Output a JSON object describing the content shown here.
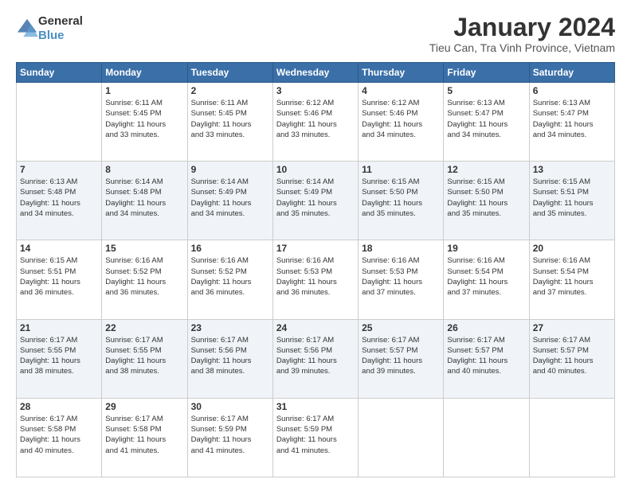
{
  "header": {
    "logo_general": "General",
    "logo_blue": "Blue",
    "title": "January 2024",
    "subtitle": "Tieu Can, Tra Vinh Province, Vietnam"
  },
  "days_of_week": [
    "Sunday",
    "Monday",
    "Tuesday",
    "Wednesday",
    "Thursday",
    "Friday",
    "Saturday"
  ],
  "weeks": [
    [
      {
        "day": "",
        "info": ""
      },
      {
        "day": "1",
        "info": "Sunrise: 6:11 AM\nSunset: 5:45 PM\nDaylight: 11 hours\nand 33 minutes."
      },
      {
        "day": "2",
        "info": "Sunrise: 6:11 AM\nSunset: 5:45 PM\nDaylight: 11 hours\nand 33 minutes."
      },
      {
        "day": "3",
        "info": "Sunrise: 6:12 AM\nSunset: 5:46 PM\nDaylight: 11 hours\nand 33 minutes."
      },
      {
        "day": "4",
        "info": "Sunrise: 6:12 AM\nSunset: 5:46 PM\nDaylight: 11 hours\nand 34 minutes."
      },
      {
        "day": "5",
        "info": "Sunrise: 6:13 AM\nSunset: 5:47 PM\nDaylight: 11 hours\nand 34 minutes."
      },
      {
        "day": "6",
        "info": "Sunrise: 6:13 AM\nSunset: 5:47 PM\nDaylight: 11 hours\nand 34 minutes."
      }
    ],
    [
      {
        "day": "7",
        "info": "Sunrise: 6:13 AM\nSunset: 5:48 PM\nDaylight: 11 hours\nand 34 minutes."
      },
      {
        "day": "8",
        "info": "Sunrise: 6:14 AM\nSunset: 5:48 PM\nDaylight: 11 hours\nand 34 minutes."
      },
      {
        "day": "9",
        "info": "Sunrise: 6:14 AM\nSunset: 5:49 PM\nDaylight: 11 hours\nand 34 minutes."
      },
      {
        "day": "10",
        "info": "Sunrise: 6:14 AM\nSunset: 5:49 PM\nDaylight: 11 hours\nand 35 minutes."
      },
      {
        "day": "11",
        "info": "Sunrise: 6:15 AM\nSunset: 5:50 PM\nDaylight: 11 hours\nand 35 minutes."
      },
      {
        "day": "12",
        "info": "Sunrise: 6:15 AM\nSunset: 5:50 PM\nDaylight: 11 hours\nand 35 minutes."
      },
      {
        "day": "13",
        "info": "Sunrise: 6:15 AM\nSunset: 5:51 PM\nDaylight: 11 hours\nand 35 minutes."
      }
    ],
    [
      {
        "day": "14",
        "info": "Sunrise: 6:15 AM\nSunset: 5:51 PM\nDaylight: 11 hours\nand 36 minutes."
      },
      {
        "day": "15",
        "info": "Sunrise: 6:16 AM\nSunset: 5:52 PM\nDaylight: 11 hours\nand 36 minutes."
      },
      {
        "day": "16",
        "info": "Sunrise: 6:16 AM\nSunset: 5:52 PM\nDaylight: 11 hours\nand 36 minutes."
      },
      {
        "day": "17",
        "info": "Sunrise: 6:16 AM\nSunset: 5:53 PM\nDaylight: 11 hours\nand 36 minutes."
      },
      {
        "day": "18",
        "info": "Sunrise: 6:16 AM\nSunset: 5:53 PM\nDaylight: 11 hours\nand 37 minutes."
      },
      {
        "day": "19",
        "info": "Sunrise: 6:16 AM\nSunset: 5:54 PM\nDaylight: 11 hours\nand 37 minutes."
      },
      {
        "day": "20",
        "info": "Sunrise: 6:16 AM\nSunset: 5:54 PM\nDaylight: 11 hours\nand 37 minutes."
      }
    ],
    [
      {
        "day": "21",
        "info": "Sunrise: 6:17 AM\nSunset: 5:55 PM\nDaylight: 11 hours\nand 38 minutes."
      },
      {
        "day": "22",
        "info": "Sunrise: 6:17 AM\nSunset: 5:55 PM\nDaylight: 11 hours\nand 38 minutes."
      },
      {
        "day": "23",
        "info": "Sunrise: 6:17 AM\nSunset: 5:56 PM\nDaylight: 11 hours\nand 38 minutes."
      },
      {
        "day": "24",
        "info": "Sunrise: 6:17 AM\nSunset: 5:56 PM\nDaylight: 11 hours\nand 39 minutes."
      },
      {
        "day": "25",
        "info": "Sunrise: 6:17 AM\nSunset: 5:57 PM\nDaylight: 11 hours\nand 39 minutes."
      },
      {
        "day": "26",
        "info": "Sunrise: 6:17 AM\nSunset: 5:57 PM\nDaylight: 11 hours\nand 40 minutes."
      },
      {
        "day": "27",
        "info": "Sunrise: 6:17 AM\nSunset: 5:57 PM\nDaylight: 11 hours\nand 40 minutes."
      }
    ],
    [
      {
        "day": "28",
        "info": "Sunrise: 6:17 AM\nSunset: 5:58 PM\nDaylight: 11 hours\nand 40 minutes."
      },
      {
        "day": "29",
        "info": "Sunrise: 6:17 AM\nSunset: 5:58 PM\nDaylight: 11 hours\nand 41 minutes."
      },
      {
        "day": "30",
        "info": "Sunrise: 6:17 AM\nSunset: 5:59 PM\nDaylight: 11 hours\nand 41 minutes."
      },
      {
        "day": "31",
        "info": "Sunrise: 6:17 AM\nSunset: 5:59 PM\nDaylight: 11 hours\nand 41 minutes."
      },
      {
        "day": "",
        "info": ""
      },
      {
        "day": "",
        "info": ""
      },
      {
        "day": "",
        "info": ""
      }
    ]
  ]
}
